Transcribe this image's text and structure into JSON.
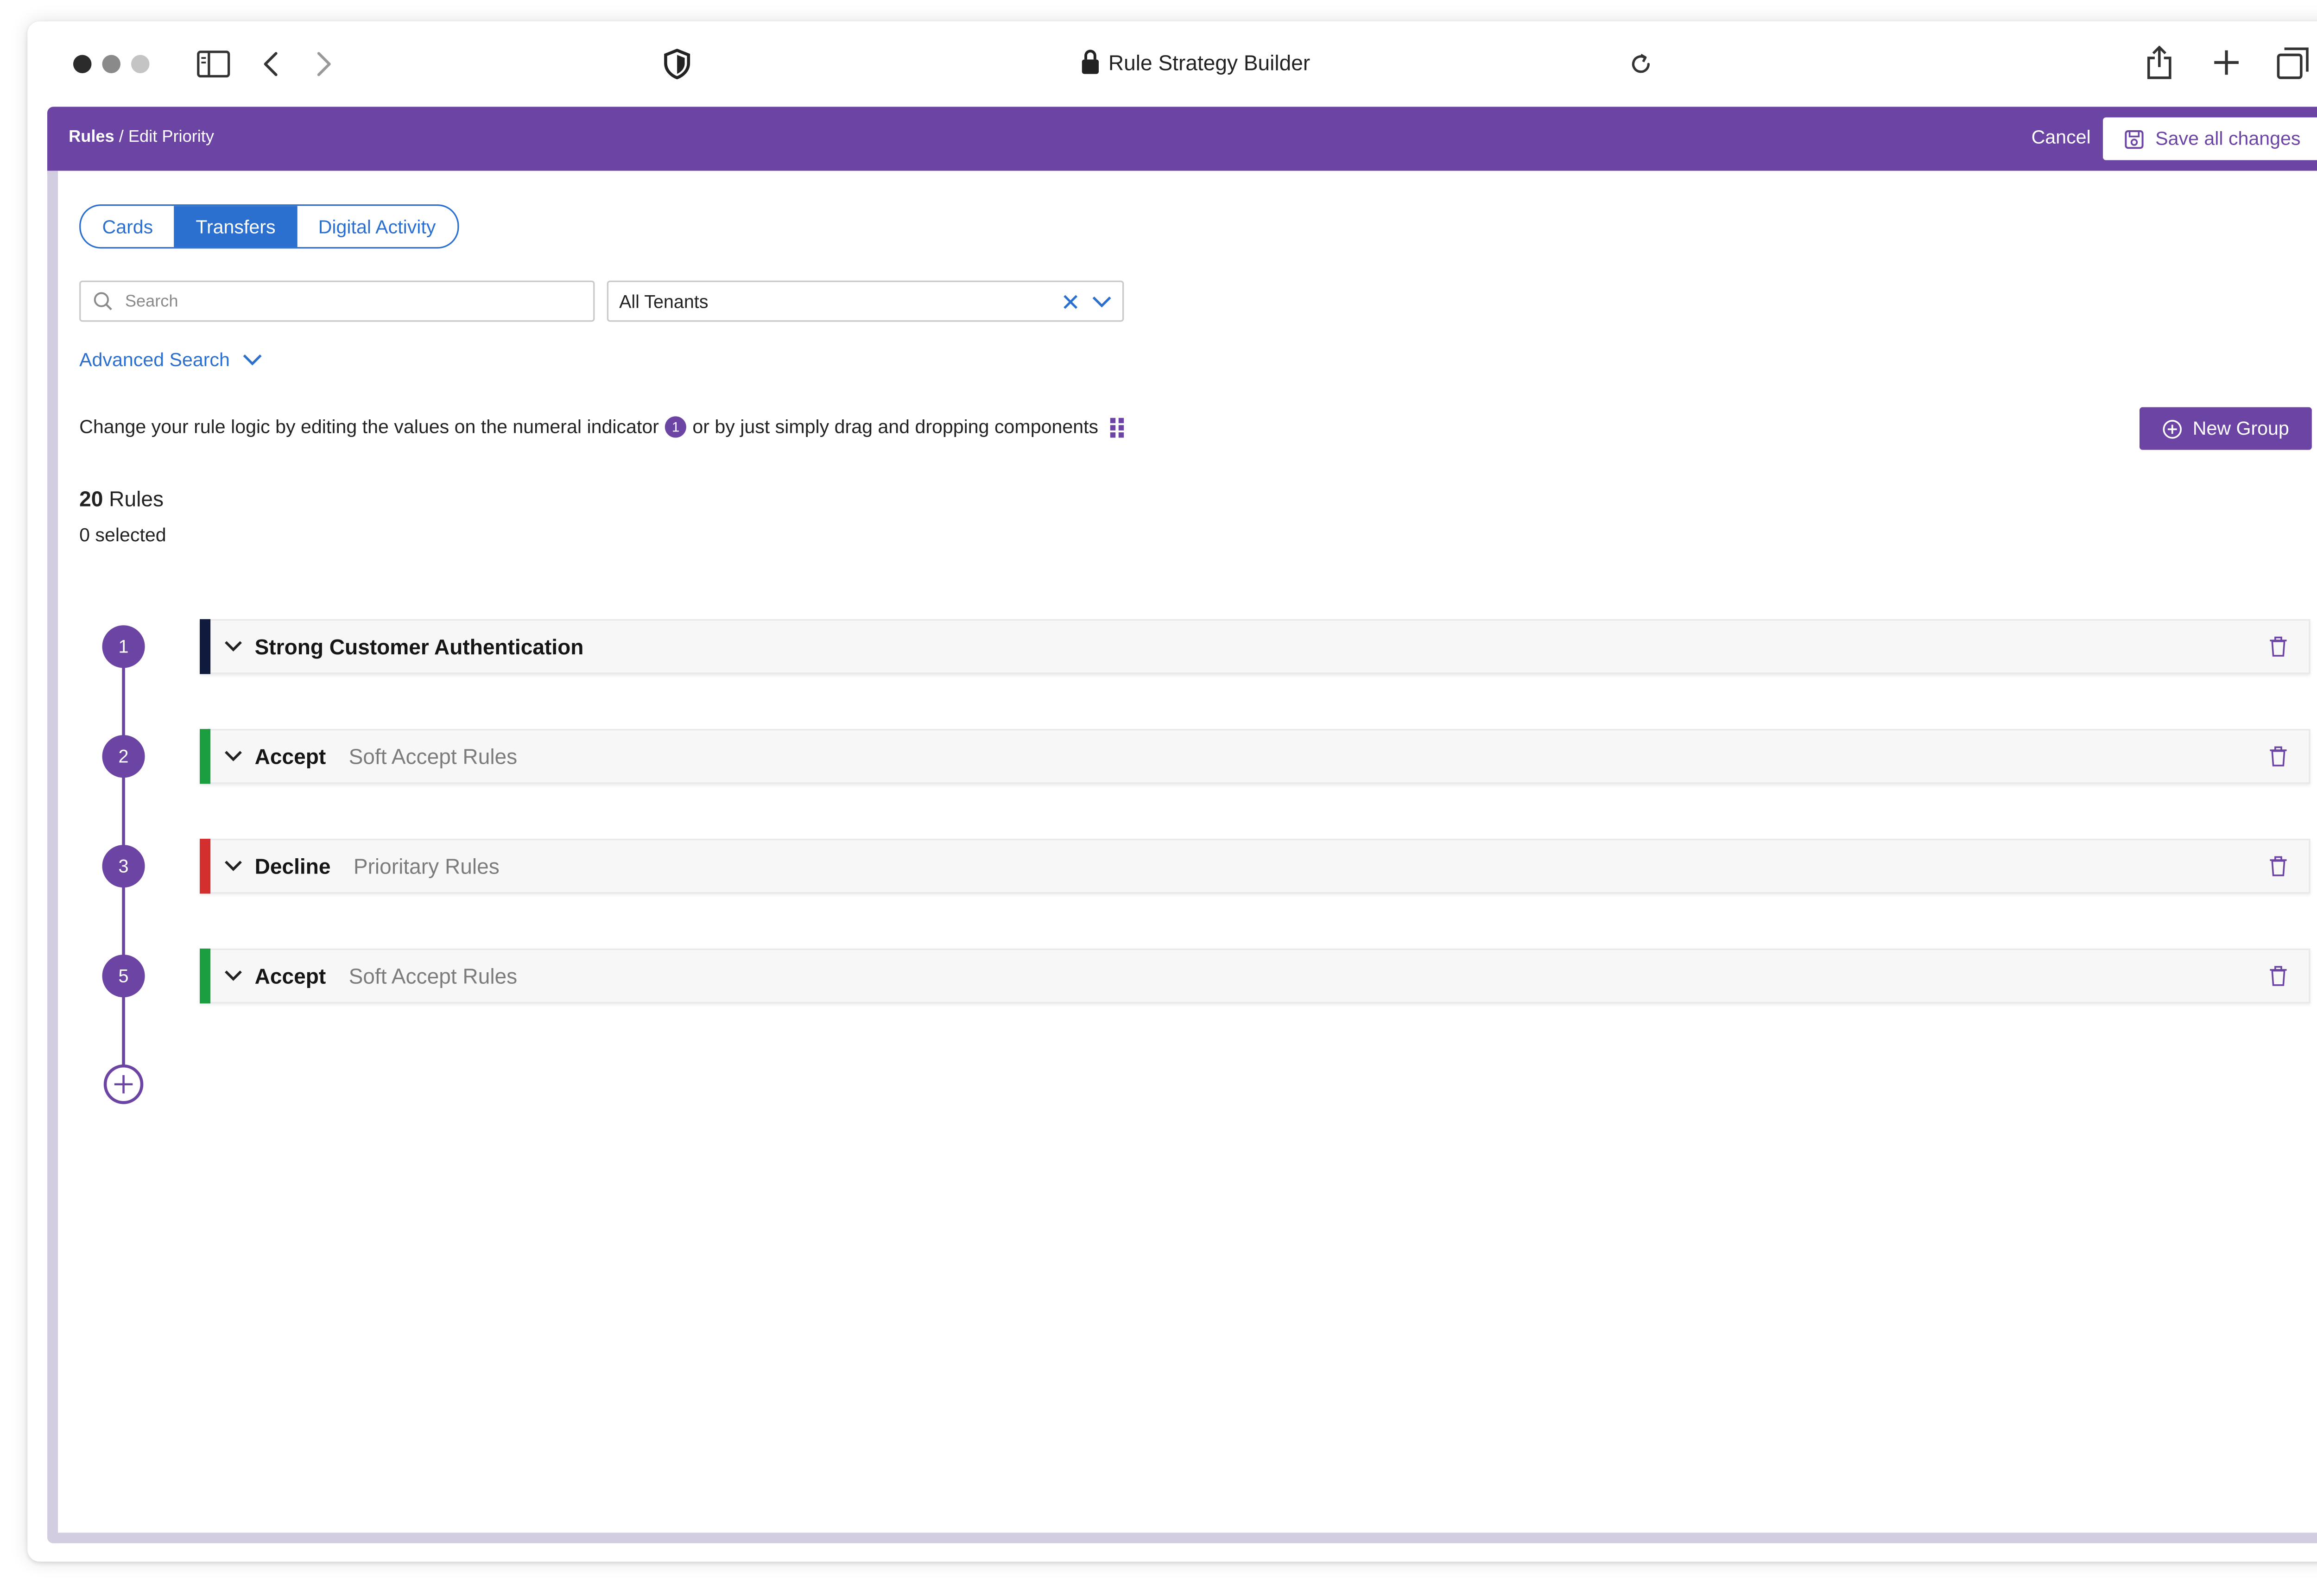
{
  "browser": {
    "title": "Rule Strategy Builder"
  },
  "header": {
    "breadcrumb_root": "Rules",
    "breadcrumb_sep": " / ",
    "breadcrumb_current": "Edit Priority",
    "cancel_label": "Cancel",
    "save_label": "Save all changes"
  },
  "tabs": [
    {
      "label": "Cards",
      "active": false
    },
    {
      "label": "Transfers",
      "active": true
    },
    {
      "label": "Digital Activity",
      "active": false
    }
  ],
  "search": {
    "placeholder": "Search",
    "value": ""
  },
  "tenant_select": {
    "value": "All Tenants"
  },
  "advanced_search_label": "Advanced Search",
  "hint": {
    "part1": "Change your rule logic by editing the values on the numeral indicator",
    "badge": "1",
    "part2": "or by just simply drag and dropping components"
  },
  "new_group_label": "New Group",
  "summary": {
    "count": "20",
    "count_label": " Rules",
    "selected": "0 selected"
  },
  "rules": [
    {
      "number": "1",
      "title": "Strong Customer Authentication",
      "subtitle": "",
      "color": "#0f1a3c"
    },
    {
      "number": "2",
      "title": "Accept",
      "subtitle": "Soft Accept Rules",
      "color": "#1a9e3f"
    },
    {
      "number": "3",
      "title": "Decline",
      "subtitle": "Prioritary Rules",
      "color": "#d32f2f"
    },
    {
      "number": "5",
      "title": "Accept",
      "subtitle": "Soft Accept Rules",
      "color": "#1a9e3f"
    }
  ],
  "colors": {
    "accent": "#6c45a4",
    "link": "#2b6fcf"
  },
  "icons": [
    "sidebar-icon",
    "back-icon",
    "forward-icon",
    "shield-icon",
    "lock-icon",
    "reload-icon",
    "share-icon",
    "new-tab-icon",
    "tabs-icon",
    "save-icon",
    "search-icon",
    "clear-icon",
    "chevron-down-icon",
    "drag-handle-icon",
    "plus-circle-icon",
    "trash-icon"
  ]
}
